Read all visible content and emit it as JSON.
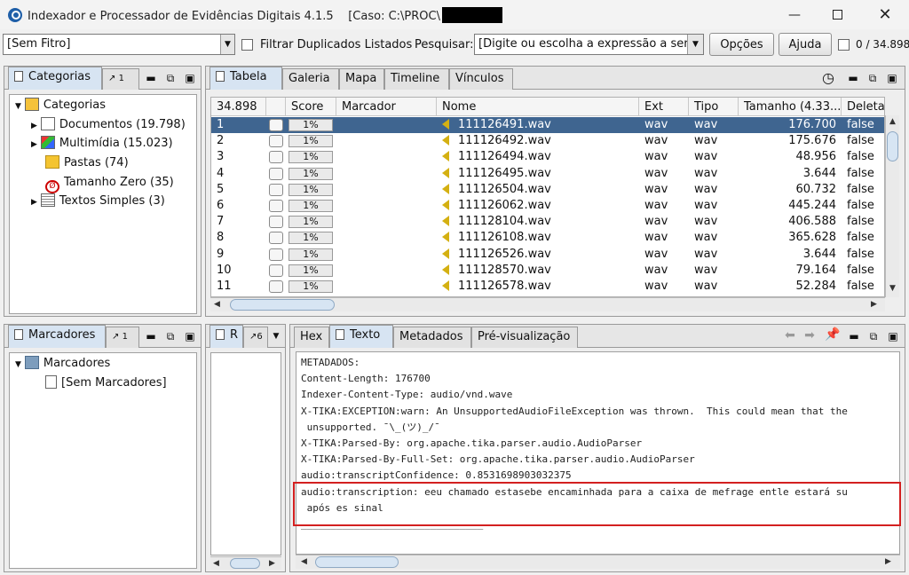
{
  "window": {
    "title": "Indexador e Processador de Evidências Digitais 4.1.5",
    "case_label": "[Caso: C:\\PROC\\"
  },
  "toolbar": {
    "filter_value": "[Sem Fitro]",
    "dup_filter_label": "Filtrar Duplicados Listados",
    "search_label": "Pesquisar:",
    "search_value": "[Digite ou escolha a expressão a ser pe",
    "options_label": "Opções",
    "help_label": "Ajuda",
    "counter": "0 / 34.898"
  },
  "categories_panel": {
    "tab_label": "Categorias",
    "tab2_badge": "1",
    "root": "Categorias",
    "items": [
      {
        "label": "Documentos (19.798)",
        "icon": "documents-icon"
      },
      {
        "label": "Multimídia (15.023)",
        "icon": "multimedia-icon"
      },
      {
        "label": "Pastas (74)",
        "icon": "folder-icon"
      },
      {
        "label": "Tamanho Zero (35)",
        "icon": "zero-size-icon"
      },
      {
        "label": "Textos Simples (3)",
        "icon": "text-icon"
      }
    ]
  },
  "results_panel": {
    "tabs": [
      "Tabela",
      "Galeria",
      "Mapa",
      "Timeline",
      "Vínculos"
    ],
    "columns": [
      "34.898",
      "",
      "Score",
      "Marcador",
      "Nome",
      "Ext",
      "Tipo",
      "Tamanho (4.33...",
      "Deletac"
    ],
    "rows": [
      {
        "n": "1",
        "score": "1%",
        "name": "111126491.wav",
        "ext": "wav",
        "type": "wav",
        "size": "176.700",
        "deleted": "false"
      },
      {
        "n": "2",
        "score": "1%",
        "name": "111126492.wav",
        "ext": "wav",
        "type": "wav",
        "size": "175.676",
        "deleted": "false"
      },
      {
        "n": "3",
        "score": "1%",
        "name": "111126494.wav",
        "ext": "wav",
        "type": "wav",
        "size": "48.956",
        "deleted": "false"
      },
      {
        "n": "4",
        "score": "1%",
        "name": "111126495.wav",
        "ext": "wav",
        "type": "wav",
        "size": "3.644",
        "deleted": "false"
      },
      {
        "n": "5",
        "score": "1%",
        "name": "111126504.wav",
        "ext": "wav",
        "type": "wav",
        "size": "60.732",
        "deleted": "false"
      },
      {
        "n": "6",
        "score": "1%",
        "name": "111126062.wav",
        "ext": "wav",
        "type": "wav",
        "size": "445.244",
        "deleted": "false"
      },
      {
        "n": "7",
        "score": "1%",
        "name": "111128104.wav",
        "ext": "wav",
        "type": "wav",
        "size": "406.588",
        "deleted": "false"
      },
      {
        "n": "8",
        "score": "1%",
        "name": "111126108.wav",
        "ext": "wav",
        "type": "wav",
        "size": "365.628",
        "deleted": "false"
      },
      {
        "n": "9",
        "score": "1%",
        "name": "111126526.wav",
        "ext": "wav",
        "type": "wav",
        "size": "3.644",
        "deleted": "false"
      },
      {
        "n": "10",
        "score": "1%",
        "name": "111128570.wav",
        "ext": "wav",
        "type": "wav",
        "size": "79.164",
        "deleted": "false"
      },
      {
        "n": "11",
        "score": "1%",
        "name": "111126578.wav",
        "ext": "wav",
        "type": "wav",
        "size": "52.284",
        "deleted": "false"
      }
    ]
  },
  "bookmarks_panel": {
    "tab_label": "Marcadores",
    "tab2_badge": "1",
    "root": "Marcadores",
    "items": [
      "[Sem Marcadores]"
    ]
  },
  "side_panel": {
    "tab_label": "R",
    "tab2_badge": "6"
  },
  "viewer_panel": {
    "tabs": [
      "Hex",
      "Texto",
      "Metadados",
      "Pré-visualização"
    ],
    "lines": [
      "METADADOS:",
      "Content-Length: 176700",
      "Indexer-Content-Type: audio/vnd.wave",
      "X-TIKA:EXCEPTION:warn: An UnsupportedAudioFileException was thrown.  This could mean that the",
      " unsupported. ¯\\_(ツ)_/¯",
      "X-TIKA:Parsed-By: org.apache.tika.parser.audio.AudioParser",
      "X-TIKA:Parsed-By-Full-Set: org.apache.tika.parser.audio.AudioParser",
      "audio:transcriptConfidence: 0.8531698903032375",
      "audio:transcription: eeu chamado estasebe encaminhada para a caixa de mefrage entle estará su",
      " após es sinal",
      "_______________________________"
    ]
  }
}
